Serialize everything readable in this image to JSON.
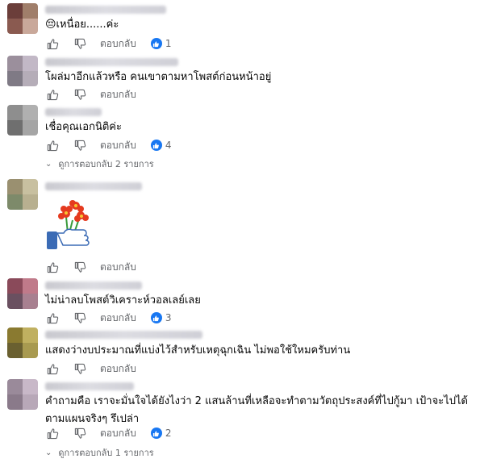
{
  "comments": [
    {
      "text": "😔เหนื่อย......ค่ะ",
      "reply_label": "ตอบกลับ",
      "reaction_count": "1",
      "avatar_colors": [
        "#6b3e3a",
        "#a07e6a",
        "#8a5a50",
        "#c9a89a"
      ]
    },
    {
      "text": "โผล่มาอีกแล้วหรือ คนเขาตามหาโพสต์ก่อนหน้าอยู่",
      "reply_label": "ตอบกลับ",
      "avatar_colors": [
        "#9b8f9c",
        "#c2b8c6",
        "#7f7a85",
        "#b5adb8"
      ]
    },
    {
      "text": "เชื่อคุณเอกนิติค่ะ",
      "reply_label": "ตอบกลับ",
      "reaction_count": "4",
      "view_replies": "ดูการตอบกลับ 2 รายการ",
      "avatar_colors": [
        "#8e8e8e",
        "#b0b0b0",
        "#6f6f6f",
        "#a5a5a5"
      ]
    },
    {
      "text": "",
      "reply_label": "ตอบกลับ",
      "sticker": "flower-thumbs-up-sticker",
      "avatar_colors": [
        "#9a9070",
        "#c8c0a0",
        "#7d8a6a",
        "#b8b090"
      ]
    },
    {
      "text": "ไม่น่าลบโพสต์วิเคราะห์วอลเลย์เลย",
      "reply_label": "ตอบกลับ",
      "reaction_count": "3",
      "avatar_colors": [
        "#8a4a5a",
        "#c07a8a",
        "#6a5060",
        "#a88090"
      ]
    },
    {
      "text": "แสดงว่างบประมาณที่แบ่งไว้สำหรับเหตุฉุกเฉิน ไม่พอใช้ใหมครับท่าน",
      "reply_label": "ตอบกลับ",
      "avatar_colors": [
        "#8a7a30",
        "#c0b060",
        "#6a6030",
        "#a89a50"
      ]
    },
    {
      "text": "คำถามคือ เราจะมั่นใจได้ยังไงว่า 2 แสนล้านที่เหลือจะทำตามวัตถุประสงค์ที่ไปกู้มา เป้าจะไปได้ตามแผนจริงๆ รึเปล่า",
      "reply_label": "ตอบกลับ",
      "reaction_count": "2",
      "view_replies": "ดูการตอบกลับ 1 รายการ",
      "avatar_colors": [
        "#9a8a9a",
        "#c8b8c8",
        "#8a7a8a",
        "#b8a8b8"
      ]
    }
  ],
  "colors": {
    "accent": "#1877f2",
    "muted": "#65676b",
    "text": "#050505"
  }
}
